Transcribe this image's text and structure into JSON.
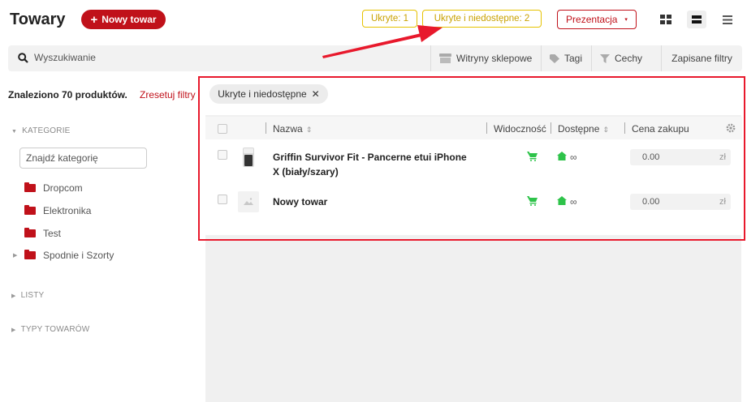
{
  "header": {
    "title": "Towary",
    "new_button": "Nowy towar",
    "new_button_icon": "+",
    "badge_hidden": "Ukryte: 1",
    "badge_hidden_unavailable": "Ukryte i niedostępne: 2",
    "presentation_label": "Prezentacja",
    "presentation_caret": "▾"
  },
  "search": {
    "placeholder": "Wyszukiwanie"
  },
  "toolbar": {
    "shops": "Witryny sklepowe",
    "tags": "Tagi",
    "features": "Cechy",
    "saved_filters": "Zapisane filtry"
  },
  "results": {
    "found_text": "Znaleziono 70 produktów.",
    "reset_text": "Zresetuj filtry"
  },
  "active_filter": {
    "label": "Ukryte i niedostępne",
    "remove_icon": "✕"
  },
  "sidebar": {
    "categories_heading": "KATEGORIE",
    "categories_tri": "▼",
    "category_search_placeholder": "Znajdź kategorię",
    "categories": [
      "Dropcom",
      "Elektronika",
      "Test",
      "Spodnie i Szorty"
    ],
    "expand_icon": "▶",
    "lists_heading": "LISTY",
    "types_heading": "TYPY TOWARÓW",
    "collapsed_tri": "▶"
  },
  "table": {
    "columns": {
      "name": "Nazwa",
      "visibility": "Widoczność",
      "available": "Dostępne",
      "purchase_price": "Cena zakupu"
    },
    "sort_icon": "⇕",
    "rows": [
      {
        "name_line1": "Griffin Survivor Fit - Pancerne etui iPhone",
        "name_line2": "X (biały/szary)",
        "stock": "∞",
        "price": "0.00",
        "currency": "zł"
      },
      {
        "name_line1": "Nowy towar",
        "stock": "∞",
        "price": "0.00",
        "currency": "zł"
      }
    ]
  },
  "colors": {
    "brand_red": "#c0111a",
    "badge_yellow": "#e6c200",
    "status_green": "#2ec34a",
    "highlight_red": "#e8192c"
  }
}
